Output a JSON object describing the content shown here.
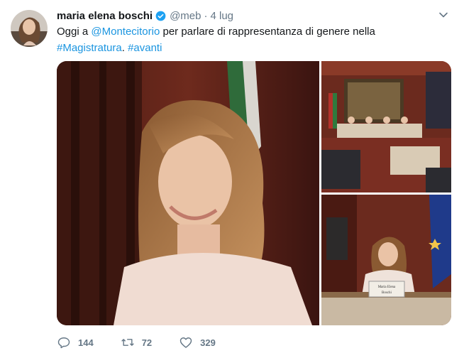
{
  "tweet": {
    "author_name": "maria elena boschi",
    "handle": "@meb",
    "separator": "·",
    "time": "4 lug",
    "text_parts": {
      "p1": "Oggi a ",
      "mention": "@Montecitorio",
      "p2": " per parlare di rappresentanza di genere nella",
      "hashtag1": "#Magistratura",
      "p3": ". ",
      "hashtag2": "#avanti"
    },
    "media": {
      "nameplate": "Maria Elena\nBoschi"
    },
    "actions": {
      "reply_count": "144",
      "retweet_count": "72",
      "like_count": "329"
    }
  },
  "colors": {
    "link": "#1b95e0",
    "secondary_text": "#657786",
    "verified": "#1da1f2"
  },
  "icons": [
    "verified-icon",
    "chevron-down-icon",
    "reply-icon",
    "retweet-icon",
    "like-icon"
  ]
}
